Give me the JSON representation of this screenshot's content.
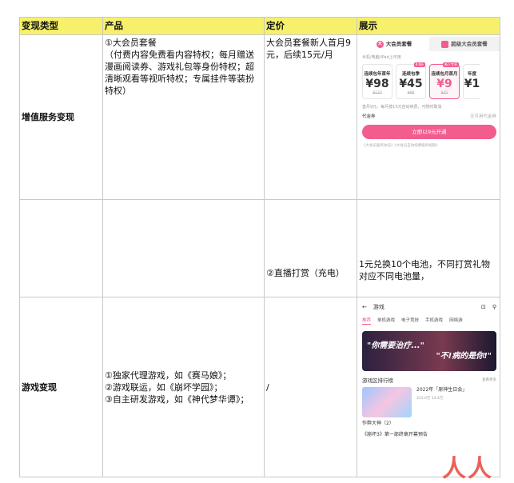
{
  "headers": [
    "变现类型",
    "产品",
    "定价",
    "展示"
  ],
  "rows": [
    {
      "type": "增值服务变现",
      "product": "①大会员套餐\n（付费内容免费看内容特权；每月赠送漫画阅读券、游戏礼包等身份特权；超清晰观看等视听特权；专属挂件等装扮特权）",
      "price": "大会员套餐新人首月9元，后续15元/月"
    },
    {
      "type": "",
      "product": "",
      "price": "②直播打赏（充电）",
      "display": "1元兑换10个电池，不同打赏礼物对应不同电池量，"
    },
    {
      "type": "游戏变现",
      "product": "①独家代理游戏，如《赛马娘》；\n②游戏联运，如《崩坏学园》；\n③自主研发游戏，如《神代梦华谭》；",
      "price": "/"
    }
  ],
  "membership_card": {
    "tab_big": "大会员套餐",
    "tab_super": "超级大会员套餐",
    "sub": "手机/电脑/iPad上可用",
    "plans": [
      {
        "name": "连续包年首年",
        "price": "98",
        "old": "¥233"
      },
      {
        "name": "连续包季",
        "price": "45",
        "old": "¥68",
        "badge": "8.6折"
      },
      {
        "name": "连续包月首月",
        "price": "9",
        "old": "¥25",
        "badge": "新人专享"
      },
      {
        "name": "年度",
        "price": "1"
      }
    ],
    "note": "首月9元，每月按15元自动续费，可随时取消",
    "coupon_label": "代金券",
    "coupon_value": "无可用代金券",
    "button": "立即以9元开通",
    "agree": "《大会员服务协议》《大会员自动续费服务规则》"
  },
  "game_card": {
    "title": "游戏",
    "nav": [
      "推荐",
      "单机游戏",
      "电子竞技",
      "手机游戏",
      "网络游"
    ],
    "banner_1": "\"你需要治疗...\"",
    "banner_2": "\"不!病的是你!\"",
    "rank_title": "游戏区排行榜",
    "rank_more": "查看更多",
    "item_title": "2022年「原神生日会」",
    "item_meta": "313.0万   14.4万",
    "list": [
      "作弊大神（2）",
      "《崩坏3》第一部终章开幕预告"
    ]
  },
  "watermark": "人人都是"
}
